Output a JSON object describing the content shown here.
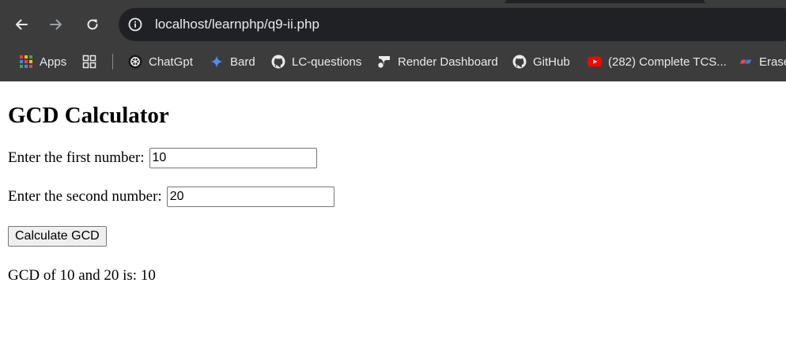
{
  "browser": {
    "url": "localhost/learnphp/q9-ii.php",
    "bookmarks": [
      {
        "label": "Apps",
        "icon": "apps-grid-icon"
      },
      {
        "label": "",
        "icon": "tab-groups-icon"
      },
      {
        "label": "ChatGpt",
        "icon": "chatgpt-icon"
      },
      {
        "label": "Bard",
        "icon": "bard-sparkle-icon"
      },
      {
        "label": "LC-questions",
        "icon": "github-icon"
      },
      {
        "label": "Render Dashboard",
        "icon": "render-icon"
      },
      {
        "label": "GitHub",
        "icon": "github-icon"
      },
      {
        "label": "(282) Complete TCS...",
        "icon": "youtube-icon"
      },
      {
        "label": "Erase",
        "icon": "eraser-icon"
      }
    ]
  },
  "page": {
    "title": "GCD Calculator",
    "first_label": "Enter the first number:",
    "first_value": "10",
    "second_label": "Enter the second number:",
    "second_value": "20",
    "button_label": "Calculate GCD",
    "result": "GCD of 10 and 20 is: 10"
  },
  "colors": {
    "chrome_bg": "#3c3c3c",
    "omnibox_bg": "#202124",
    "chrome_text": "#e8eaed",
    "youtube_red": "#ff0000",
    "bard_blue": "#4e8df5"
  }
}
